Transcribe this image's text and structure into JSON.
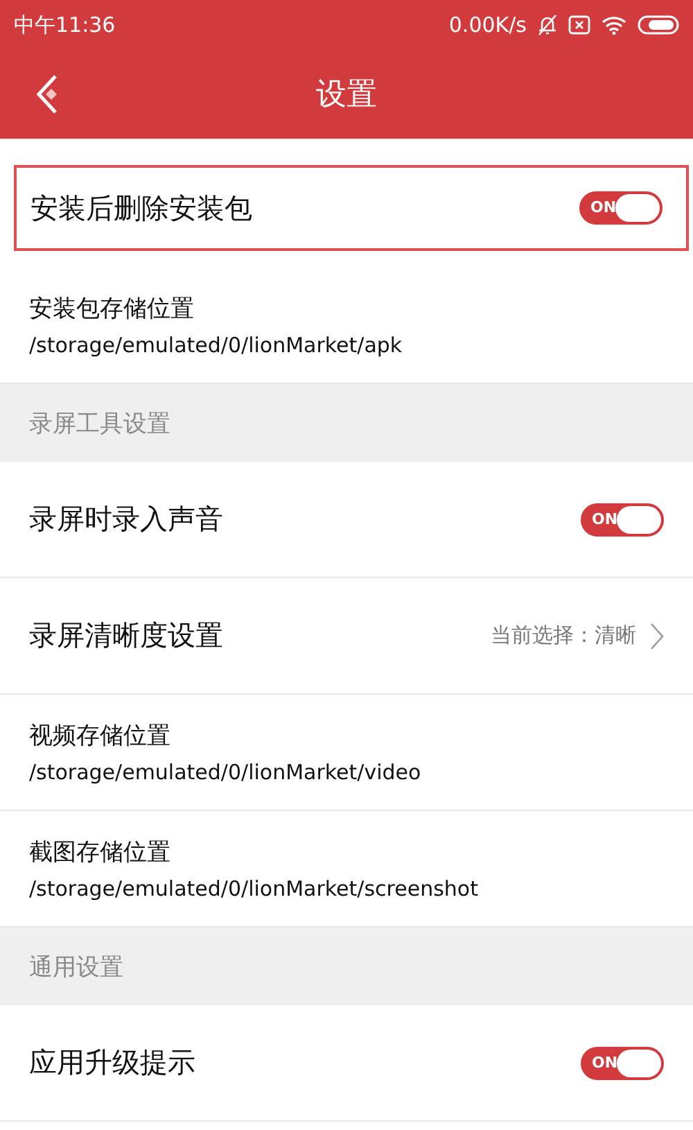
{
  "status_bar": {
    "time": "中午11:36",
    "speed": "0.00K/s"
  },
  "header": {
    "title": "设置"
  },
  "items": [
    {
      "kind": "toggle",
      "label": "安装后删除安装包",
      "on": true,
      "on_text": "ON",
      "highlighted": true
    },
    {
      "kind": "path",
      "label": "安装包存储位置",
      "value": "/storage/emulated/0/lionMarket/apk"
    },
    {
      "kind": "section",
      "label": "录屏工具设置"
    },
    {
      "kind": "toggle",
      "label": "录屏时录入声音",
      "on": true,
      "on_text": "ON",
      "highlighted": false
    },
    {
      "kind": "select",
      "label": "录屏清晰度设置",
      "value": "当前选择：清晰"
    },
    {
      "kind": "path",
      "label": "视频存储位置",
      "value": "/storage/emulated/0/lionMarket/video"
    },
    {
      "kind": "path",
      "label": "截图存储位置",
      "value": "/storage/emulated/0/lionMarket/screenshot"
    },
    {
      "kind": "section",
      "label": "通用设置"
    },
    {
      "kind": "toggle",
      "label": "应用升级提示",
      "on": true,
      "on_text": "ON",
      "highlighted": false
    }
  ]
}
